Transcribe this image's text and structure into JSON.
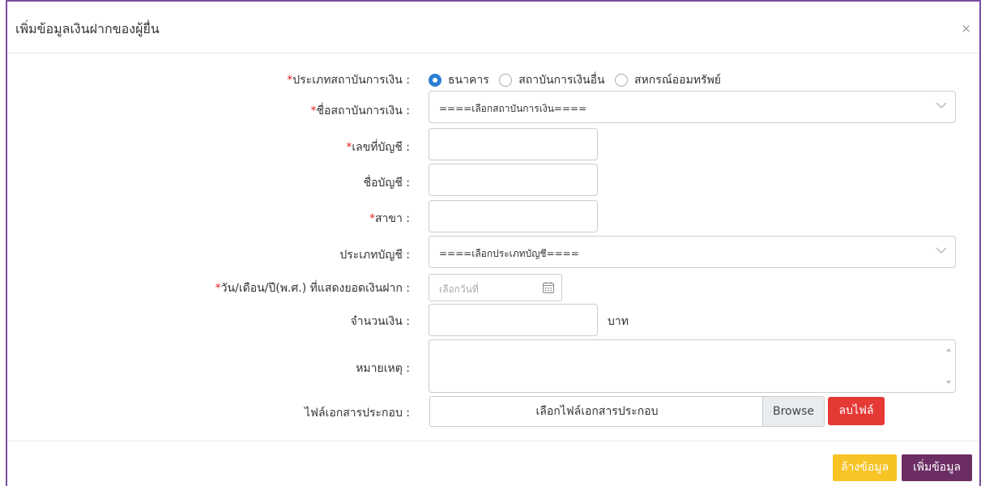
{
  "dialog": {
    "title": "เพิ่มข้อมูลเงินฝากของผู้ยื่น",
    "close_glyph": "×"
  },
  "form": {
    "institution_type": {
      "required_mark": "*",
      "label": "ประเภทสถาบันการเงิน :",
      "options": [
        "ธนาคาร",
        "สถาบันการเงินอื่น",
        "สหกรณ์ออมทรัพย์"
      ],
      "selected": "ธนาคาร"
    },
    "institution_name": {
      "required_mark": "*",
      "label": "ชื่อสถาบันการเงิน :",
      "value": "====เลือกสถาบันการเงิน===="
    },
    "account_number": {
      "required_mark": "*",
      "label": "เลขที่บัญชี :",
      "value": ""
    },
    "account_name": {
      "label": "ชื่อบัญชี :",
      "value": ""
    },
    "branch": {
      "required_mark": "*",
      "label": "สาขา :",
      "value": ""
    },
    "account_type": {
      "label": "ประเภทบัญชี :",
      "value": "====เลือกประเภทบัญชี===="
    },
    "balance_date": {
      "required_mark": "*",
      "label": "วัน/เดือน/ปี(พ.ศ.) ที่แสดงยอดเงินฝาก :",
      "placeholder": "เลือกวันที่"
    },
    "amount": {
      "label": "จำนวนเงิน :",
      "value": "",
      "unit": "บาท"
    },
    "note": {
      "label": "หมายเหตุ :",
      "value": ""
    },
    "attachment": {
      "label": "ไฟล์เอกสารประกอบ :",
      "file_text": "เลือกไฟล์เอกสารประกอบ",
      "browse_label": "Browse",
      "delete_label": "ลบไฟล์"
    }
  },
  "footer": {
    "clear_label": "ล้างข้อมูล",
    "add_label": "เพิ่มข้อมูล"
  },
  "colors": {
    "accent_purple": "#6b2d63",
    "clear_yellow": "#f7c325",
    "delete_red": "#e53935",
    "radio_blue": "#2a7fd4",
    "required_red": "#e02424"
  },
  "icons": [
    "close-icon",
    "chevron-down-icon",
    "calendar-icon"
  ]
}
